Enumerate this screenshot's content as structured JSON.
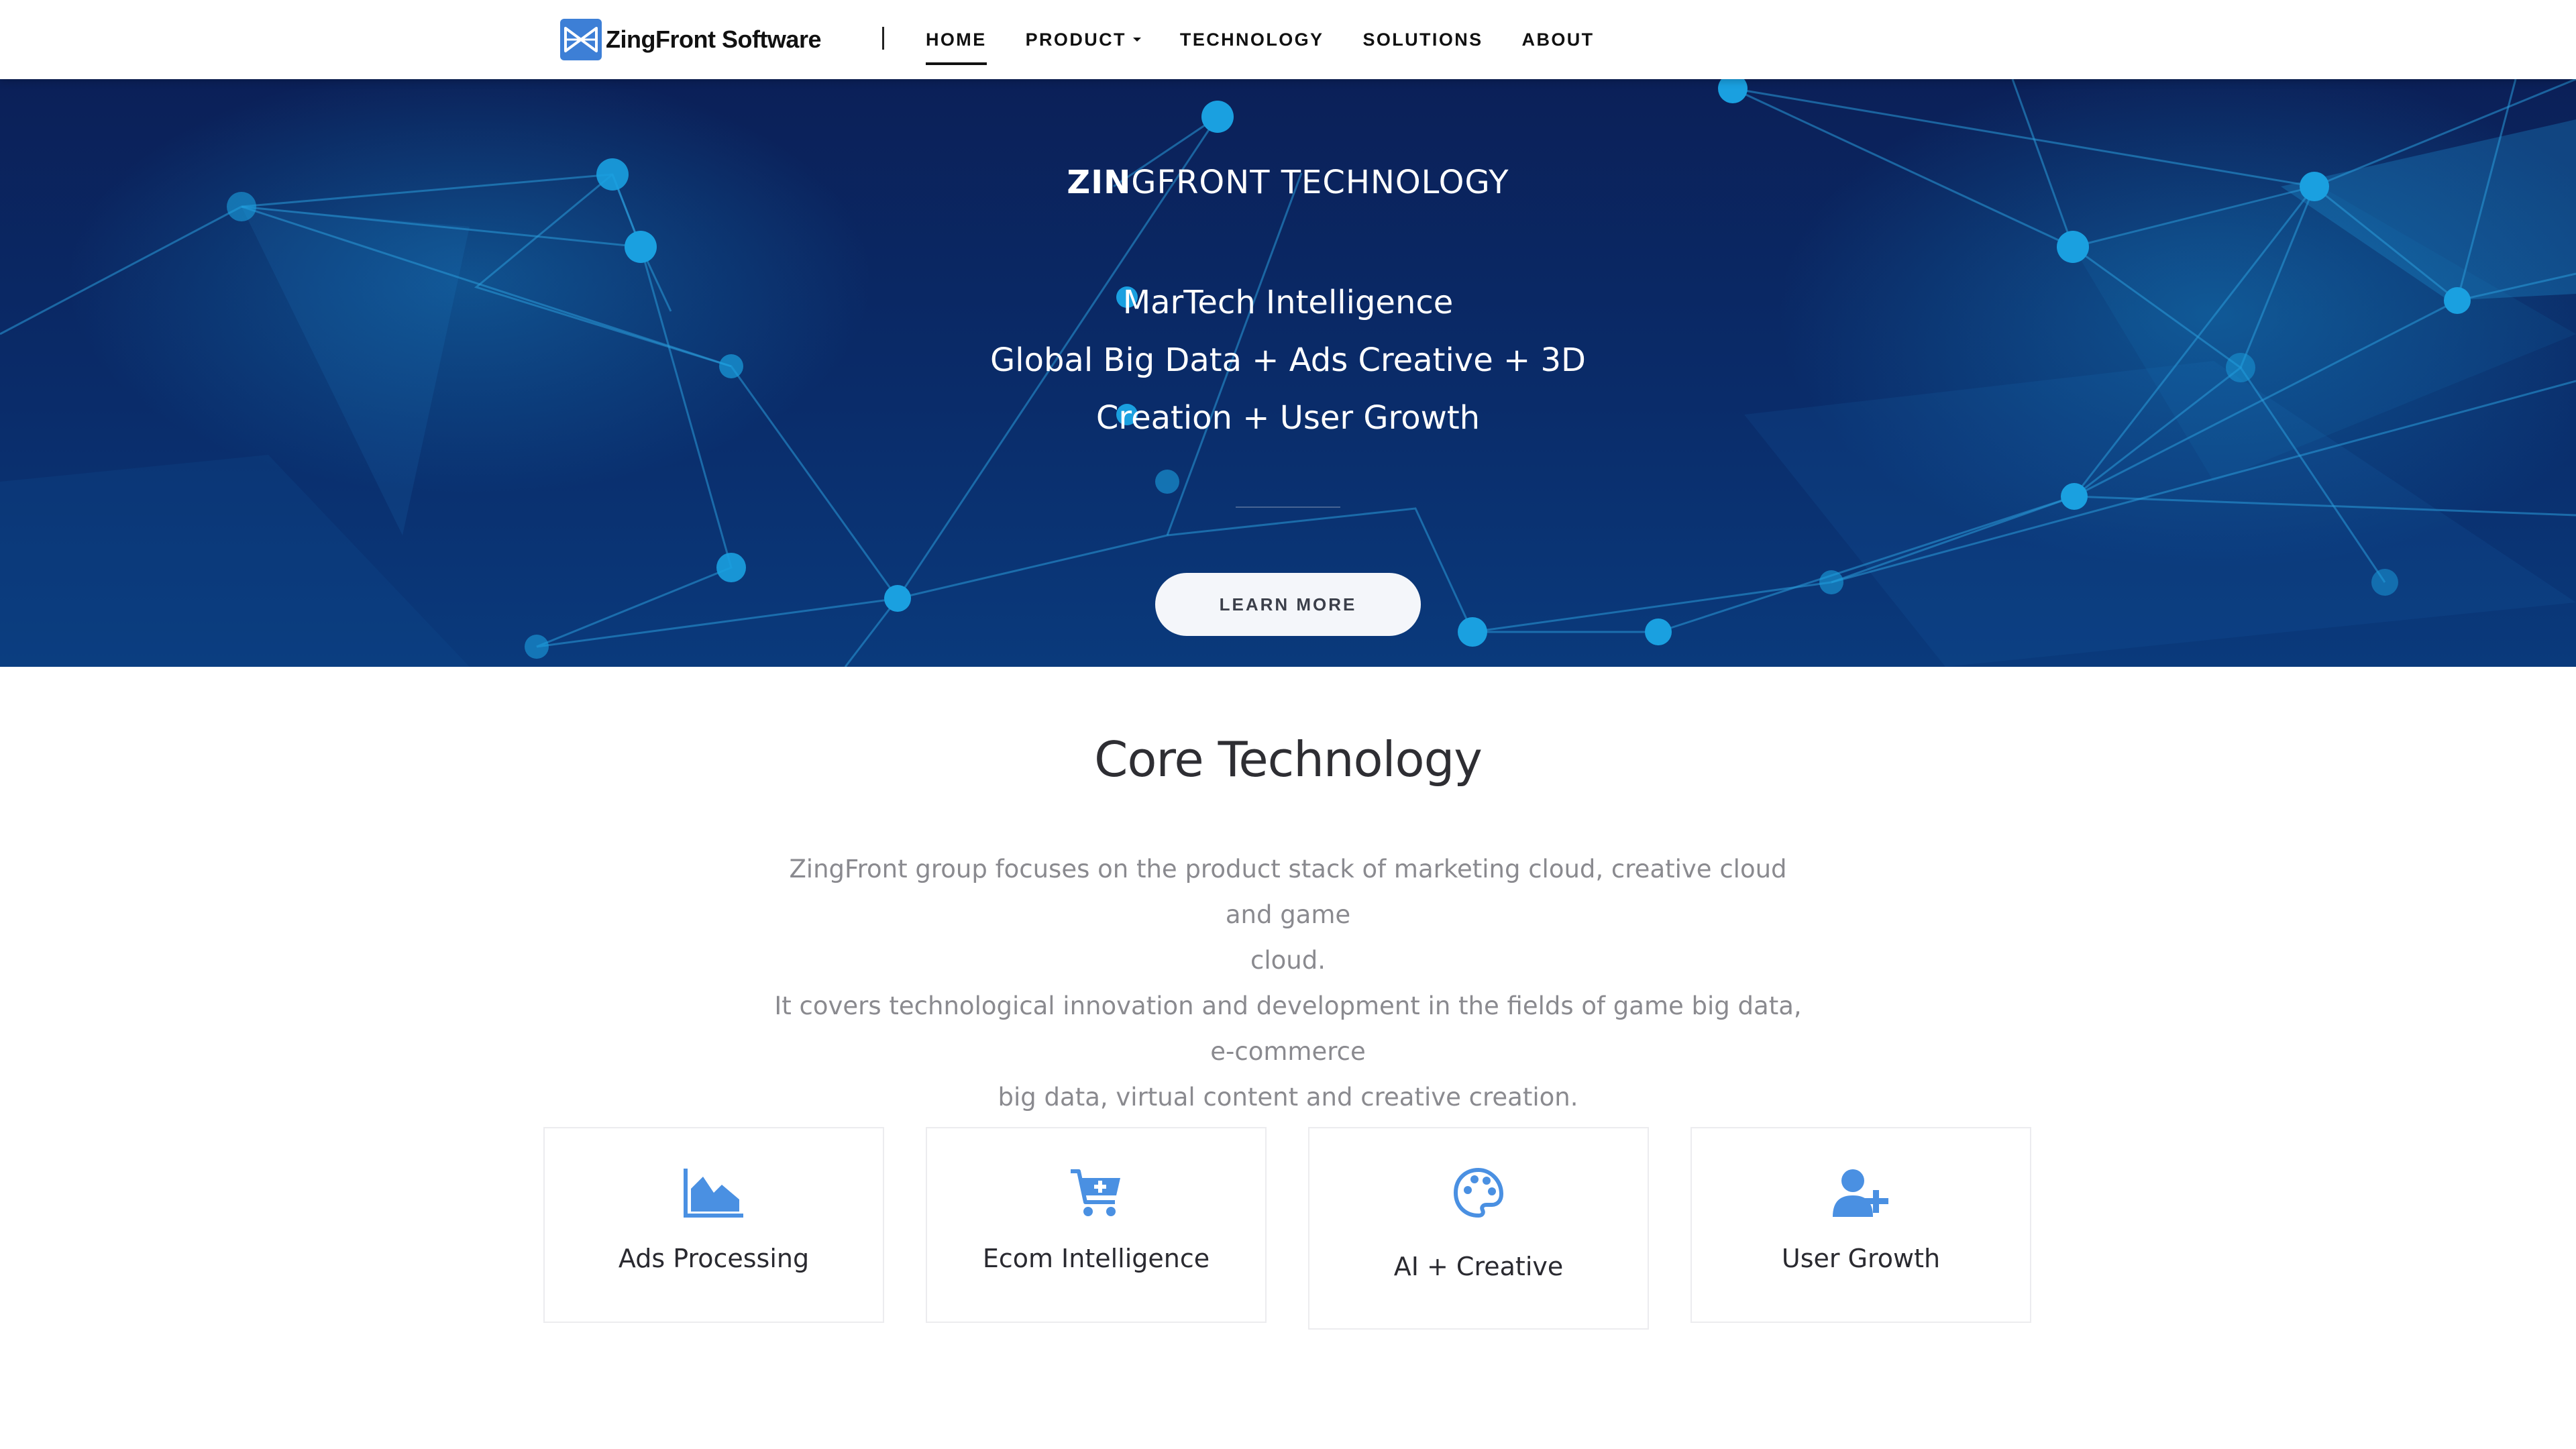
{
  "brand": {
    "name": "ZingFront Software",
    "logo_icon": "zingfront-logo-icon",
    "accent": "#3d7fd6"
  },
  "nav": {
    "items": [
      {
        "label": "HOME",
        "active": true
      },
      {
        "label": "PRODUCT",
        "has_dropdown": true
      },
      {
        "label": "TECHNOLOGY"
      },
      {
        "label": "SOLUTIONS"
      },
      {
        "label": "ABOUT"
      }
    ]
  },
  "hero": {
    "title_bold": "ZIN",
    "title_rest": "GFRONT TECHNOLOGY",
    "lines": [
      "MarTech Intelligence",
      "Global Big Data + Ads Creative + 3D",
      "Creation + User Growth"
    ],
    "button": "LEARN MORE",
    "background_color": "#0b2058"
  },
  "core": {
    "title": "Core Technology",
    "description_lines": [
      "ZingFront group focuses on the product stack of marketing cloud, creative cloud and game",
      "cloud.",
      "It covers technological innovation and development in the fields of game big data, e-commerce",
      "big data, virtual content and creative creation."
    ],
    "cards": [
      {
        "label": "Ads Processing",
        "icon": "area-chart-icon"
      },
      {
        "label": "Ecom Intelligence",
        "icon": "cart-plus-icon"
      },
      {
        "label": "AI + Creative",
        "icon": "palette-icon"
      },
      {
        "label": "User Growth",
        "icon": "user-plus-icon"
      }
    ],
    "icon_color": "#4a90e2"
  }
}
